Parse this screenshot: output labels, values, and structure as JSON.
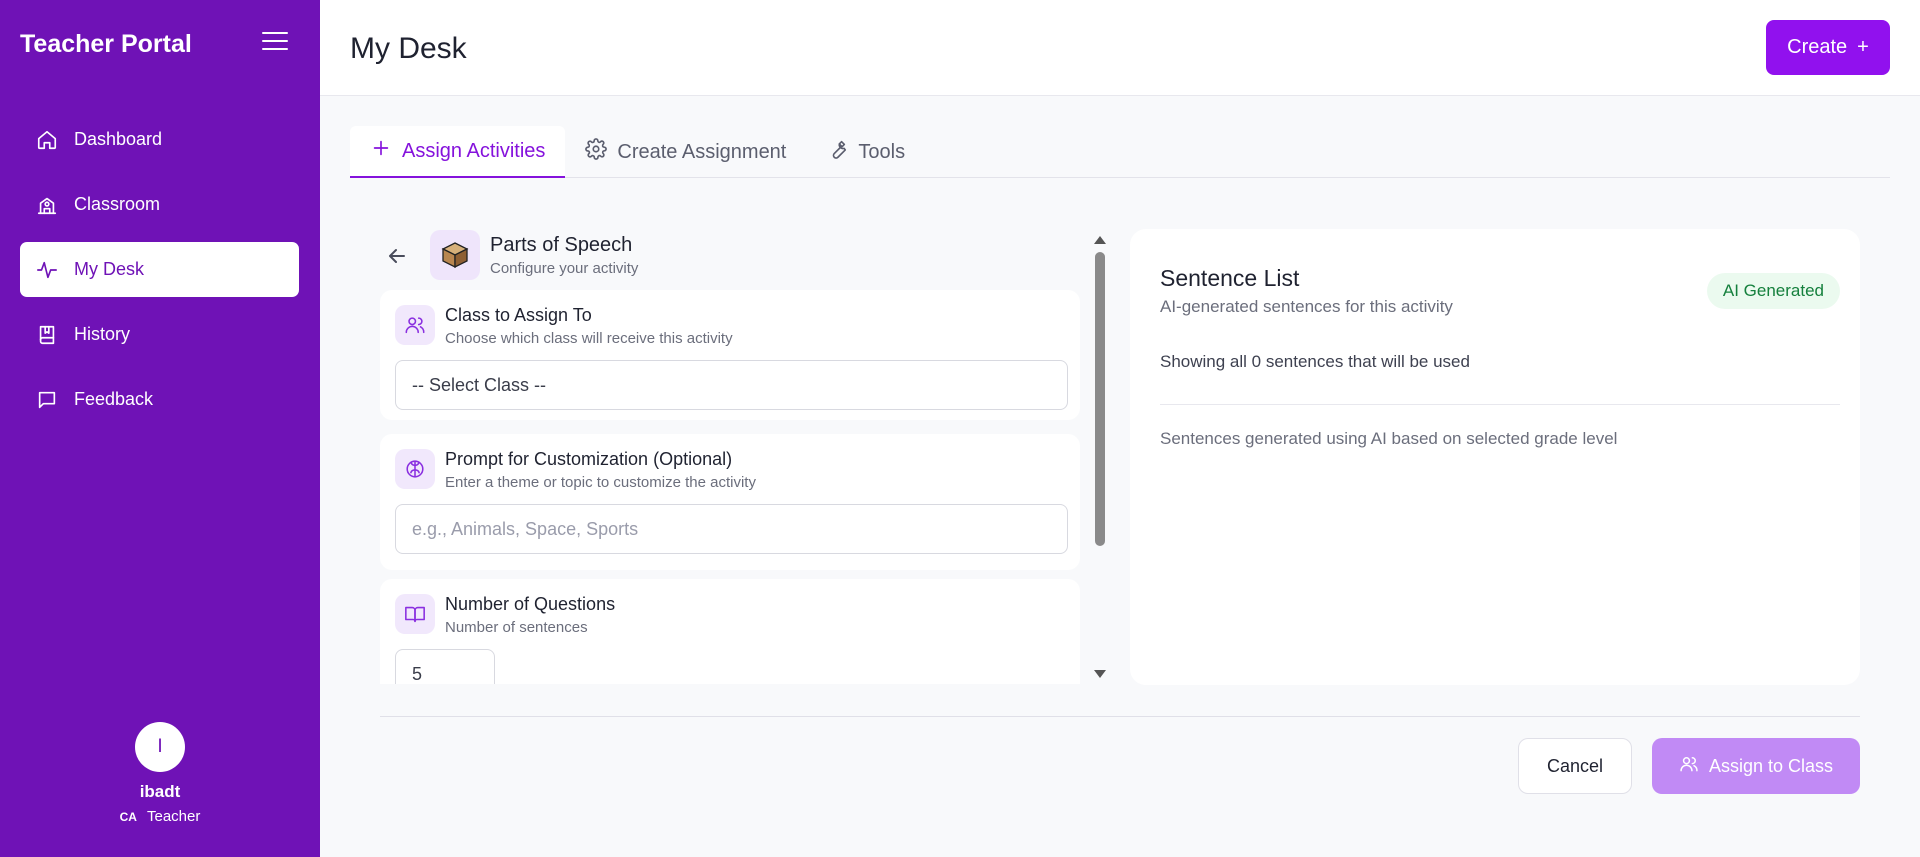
{
  "app": {
    "brand": "Teacher Portal"
  },
  "sidebar": {
    "items": [
      {
        "label": "Dashboard",
        "icon": "home-icon"
      },
      {
        "label": "Classroom",
        "icon": "school-icon"
      },
      {
        "label": "My Desk",
        "icon": "activity-icon",
        "active": true
      },
      {
        "label": "History",
        "icon": "book-bookmark-icon"
      },
      {
        "label": "Feedback",
        "icon": "message-icon"
      }
    ],
    "user": {
      "initial": "I",
      "name": "ibadt",
      "tag": "CA",
      "role": "Teacher"
    }
  },
  "header": {
    "title": "My Desk",
    "create_label": "Create",
    "create_symbol": "+"
  },
  "tabs": [
    {
      "label": "Assign Activities",
      "icon": "plus-icon",
      "active": true
    },
    {
      "label": "Create Assignment",
      "icon": "gear-icon"
    },
    {
      "label": "Tools",
      "icon": "wrench-icon"
    }
  ],
  "activity": {
    "title": "Parts of Speech",
    "subtitle": "Configure your activity"
  },
  "form": {
    "class": {
      "title": "Class to Assign To",
      "subtitle": "Choose which class will receive this activity",
      "value": "-- Select Class --"
    },
    "prompt": {
      "title": "Prompt for Customization (Optional)",
      "subtitle": "Enter a theme or topic to customize the activity",
      "placeholder": "e.g., Animals, Space, Sports"
    },
    "questions": {
      "title": "Number of Questions",
      "subtitle": "Number of sentences",
      "value": "5"
    }
  },
  "sentence_list": {
    "title": "Sentence List",
    "subtitle": "AI-generated sentences for this activity",
    "badge": "AI Generated",
    "count_text": "Showing all 0 sentences that will be used",
    "note": "Sentences generated using AI based on selected grade level"
  },
  "footer": {
    "cancel_label": "Cancel",
    "assign_label": "Assign to Class"
  },
  "colors": {
    "sidebar": "#6f12b6",
    "accent": "#9111ee",
    "badge_bg": "#ebfaef",
    "badge_text": "#15803d",
    "assign_disabled": "#c18af5"
  }
}
